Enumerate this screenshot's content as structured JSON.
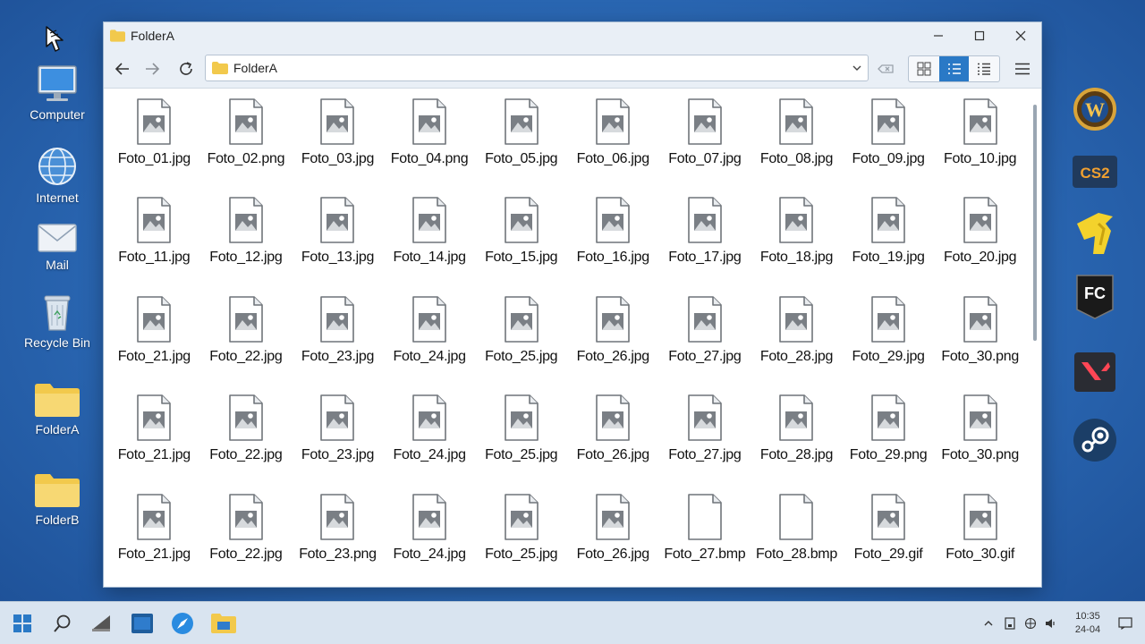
{
  "desktop": {
    "icons": [
      {
        "label": "Computer",
        "icon": "computer-icon"
      },
      {
        "label": "Internet",
        "icon": "globe-icon"
      },
      {
        "label": "Mail",
        "icon": "mail-icon"
      },
      {
        "label": "Recycle Bin",
        "icon": "recycle-bin-icon"
      },
      {
        "label": "FolderA",
        "icon": "folder-icon"
      },
      {
        "label": "FolderB",
        "icon": "folder-icon"
      }
    ],
    "apps": [
      {
        "name": "world-of-warcraft",
        "icon": "wow-icon",
        "text": "W"
      },
      {
        "name": "cs2",
        "icon": "cs2-icon",
        "text": "CS2"
      },
      {
        "name": "yellow-app",
        "icon": "yellow-app-icon",
        "text": ""
      },
      {
        "name": "fc-online",
        "icon": "fc-online-icon",
        "text": "FC"
      },
      {
        "name": "valorant",
        "icon": "valorant-icon",
        "text": ""
      },
      {
        "name": "steam",
        "icon": "steam-icon",
        "text": ""
      }
    ]
  },
  "window": {
    "title": "FolderA",
    "address": "FolderA",
    "active_view": "list",
    "accent": "#2a79c6",
    "files": [
      {
        "name": "Foto_01.jpg",
        "kind": "image"
      },
      {
        "name": "Foto_02.png",
        "kind": "image"
      },
      {
        "name": "Foto_03.jpg",
        "kind": "image"
      },
      {
        "name": "Foto_04.png",
        "kind": "image"
      },
      {
        "name": "Foto_05.jpg",
        "kind": "image"
      },
      {
        "name": "Foto_06.jpg",
        "kind": "image"
      },
      {
        "name": "Foto_07.jpg",
        "kind": "image"
      },
      {
        "name": "Foto_08.jpg",
        "kind": "image"
      },
      {
        "name": "Foto_09.jpg",
        "kind": "image"
      },
      {
        "name": "Foto_10.jpg",
        "kind": "image"
      },
      {
        "name": "Foto_11.jpg",
        "kind": "image"
      },
      {
        "name": "Foto_12.jpg",
        "kind": "image"
      },
      {
        "name": "Foto_13.jpg",
        "kind": "image"
      },
      {
        "name": "Foto_14.jpg",
        "kind": "image"
      },
      {
        "name": "Foto_15.jpg",
        "kind": "image"
      },
      {
        "name": "Foto_16.jpg",
        "kind": "image"
      },
      {
        "name": "Foto_17.jpg",
        "kind": "image"
      },
      {
        "name": "Foto_18.jpg",
        "kind": "image"
      },
      {
        "name": "Foto_19.jpg",
        "kind": "image"
      },
      {
        "name": "Foto_20.jpg",
        "kind": "image"
      },
      {
        "name": "Foto_21.jpg",
        "kind": "image"
      },
      {
        "name": "Foto_22.jpg",
        "kind": "image"
      },
      {
        "name": "Foto_23.jpg",
        "kind": "image"
      },
      {
        "name": "Foto_24.jpg",
        "kind": "image"
      },
      {
        "name": "Foto_25.jpg",
        "kind": "image"
      },
      {
        "name": "Foto_26.jpg",
        "kind": "image"
      },
      {
        "name": "Foto_27.jpg",
        "kind": "image"
      },
      {
        "name": "Foto_28.jpg",
        "kind": "image"
      },
      {
        "name": "Foto_29.jpg",
        "kind": "image"
      },
      {
        "name": "Foto_30.png",
        "kind": "image"
      },
      {
        "name": "Foto_21.jpg",
        "kind": "image"
      },
      {
        "name": "Foto_22.jpg",
        "kind": "image"
      },
      {
        "name": "Foto_23.jpg",
        "kind": "image"
      },
      {
        "name": "Foto_24.jpg",
        "kind": "image"
      },
      {
        "name": "Foto_25.jpg",
        "kind": "image"
      },
      {
        "name": "Foto_26.jpg",
        "kind": "image"
      },
      {
        "name": "Foto_27.jpg",
        "kind": "image"
      },
      {
        "name": "Foto_28.jpg",
        "kind": "image"
      },
      {
        "name": "Foto_29.png",
        "kind": "image"
      },
      {
        "name": "Foto_30.png",
        "kind": "image"
      },
      {
        "name": "Foto_21.jpg",
        "kind": "image"
      },
      {
        "name": "Foto_22.jpg",
        "kind": "image"
      },
      {
        "name": "Foto_23.png",
        "kind": "image"
      },
      {
        "name": "Foto_24.jpg",
        "kind": "image"
      },
      {
        "name": "Foto_25.jpg",
        "kind": "image"
      },
      {
        "name": "Foto_26.jpg",
        "kind": "image"
      },
      {
        "name": "Foto_27.bmp",
        "kind": "blank"
      },
      {
        "name": "Foto_28.bmp",
        "kind": "blank"
      },
      {
        "name": "Foto_29.gif",
        "kind": "image"
      },
      {
        "name": "Foto_30.gif",
        "kind": "image"
      }
    ]
  },
  "taskbar": {
    "items": [
      "start-icon",
      "search-icon",
      "file-manager-icon",
      "terminal-icon",
      "browser-icon",
      "folder-icon"
    ],
    "time": "10:35",
    "date": "24-04"
  }
}
